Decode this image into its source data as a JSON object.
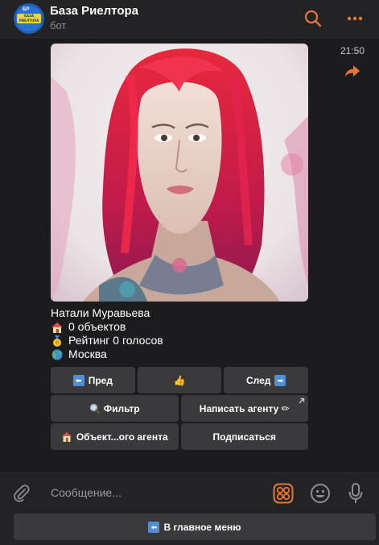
{
  "header": {
    "avatar_tag": "БР",
    "avatar_text": "БАЗА РИЕЛТОРА",
    "title": "База Риелтора",
    "subtitle": "бот"
  },
  "message": {
    "time": "21:50",
    "name": "Натали Муравьева",
    "objects": "0 объектов",
    "rating": "Рейтинг 0 голосов",
    "city": "Москва"
  },
  "keyboard": {
    "prev": "Пред",
    "like": "👍",
    "next": "След",
    "filter": "Фильтр",
    "write_agent": "Написать агенту ✏",
    "agent_objects": "Объект...ого агента",
    "subscribe": "Подписаться"
  },
  "composer": {
    "placeholder": "Сообщение...",
    "main_menu": "В главное меню"
  },
  "colors": {
    "accent": "#e8772e",
    "background": "#1c1c1e",
    "button": "#3a3a3c"
  }
}
